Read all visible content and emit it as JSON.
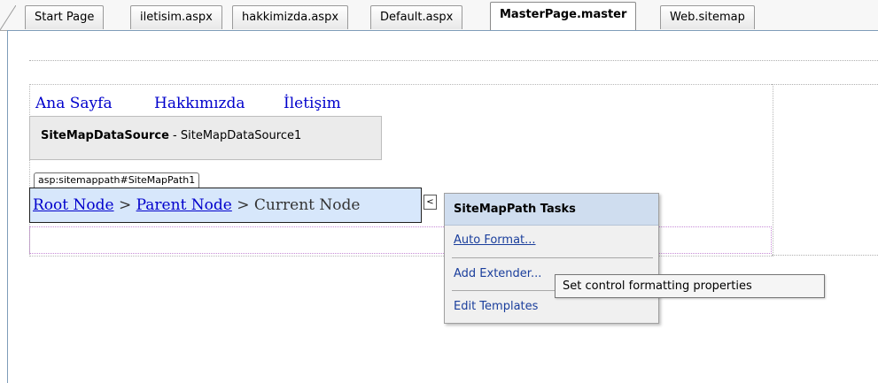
{
  "tabs": [
    {
      "label": "Start Page",
      "active": false
    },
    {
      "label": "iletisim.aspx",
      "active": false
    },
    {
      "label": "hakkimizda.aspx",
      "active": false
    },
    {
      "label": "Default.aspx",
      "active": false
    },
    {
      "label": "MasterPage.master",
      "active": true
    },
    {
      "label": "Web.sitemap",
      "active": false
    }
  ],
  "menu": {
    "items": [
      "Ana Sayfa",
      "Hakkımızda",
      "İletişim"
    ]
  },
  "datasource": {
    "type_label": "SiteMapDataSource",
    "separator": " - ",
    "id": "SiteMapDataSource1"
  },
  "sitemappath": {
    "tag": "asp:sitemappath#SiteMapPath1",
    "root": "Root Node",
    "sep1": " > ",
    "parent": "Parent Node",
    "sep2": " > ",
    "current": "Current Node"
  },
  "smart_tag_glyph": "<",
  "tasks_panel": {
    "title": "SiteMapPath Tasks",
    "items": [
      "Auto Format...",
      "Add Extender...",
      "Edit Templates"
    ]
  },
  "tooltip": "Set control formatting properties",
  "colors": {
    "link": "#0000cc",
    "selection": "#d7e7fb",
    "tasks_header": "#cfddef",
    "task_link": "#1a3e9c"
  }
}
